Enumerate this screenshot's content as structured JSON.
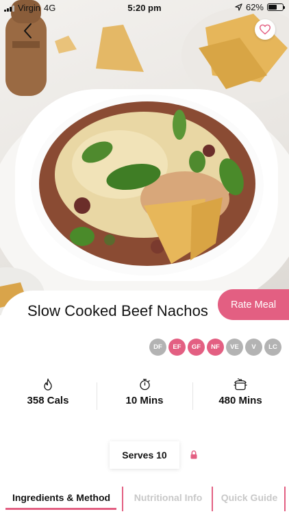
{
  "status_bar": {
    "carrier": "Virgin",
    "network": "4G",
    "time": "5:20 pm",
    "battery": "62%",
    "battery_level": 0.62,
    "icons": [
      "signal-bars-icon",
      "location-arrow-icon",
      "battery-icon"
    ]
  },
  "nav": {
    "back_icon": "chevron-left-icon",
    "favorite_icon": "heart-outline-icon"
  },
  "recipe": {
    "title": "Slow Cooked Beef Nachos",
    "rate_label": "Rate Meal"
  },
  "tags": [
    {
      "label": "DF",
      "active": false
    },
    {
      "label": "EF",
      "active": true
    },
    {
      "label": "GF",
      "active": true
    },
    {
      "label": "NF",
      "active": true
    },
    {
      "label": "VE",
      "active": false
    },
    {
      "label": "V",
      "active": false
    },
    {
      "label": "LC",
      "active": false
    }
  ],
  "stats": [
    {
      "icon": "flame-icon",
      "value": "358 Cals"
    },
    {
      "icon": "stopwatch-icon",
      "value": "10 Mins"
    },
    {
      "icon": "slow-cooker-icon",
      "value": "480 Mins"
    }
  ],
  "serves": {
    "label": "Serves 10",
    "lock_icon": "lock-icon"
  },
  "tabs": [
    {
      "label": "Ingredients & Method",
      "active": true
    },
    {
      "label": "Nutritional Info",
      "active": false
    },
    {
      "label": "Quick Guide",
      "active": false
    }
  ],
  "colors": {
    "accent": "#e35f82",
    "tag_inactive": "#b3b3b3",
    "tab_inactive": "#c8c8c8"
  }
}
